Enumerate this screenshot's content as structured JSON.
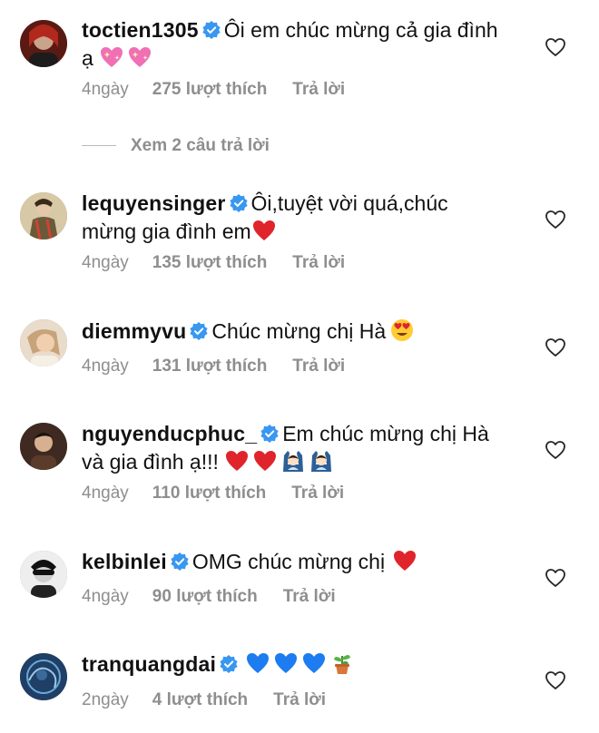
{
  "comments": [
    {
      "username": "toctien1305",
      "text": "Ôi em chúc mừng cả gia đình ạ",
      "emojis": [
        "sparkling-heart",
        "sparkling-heart"
      ],
      "time": "4ngày",
      "likes": "275 lượt thích",
      "reply": "Trả lời"
    },
    {
      "username": "lequyensinger",
      "text": "Ôi,tuyệt vời quá,chúc mừng gia đình em",
      "emojis": [
        "red-heart"
      ],
      "time": "4ngày",
      "likes": "135 lượt thích",
      "reply": "Trả lời"
    },
    {
      "username": "diemmyvu",
      "text": "Chúc mừng chị Hà",
      "emojis": [
        "heart-eyes"
      ],
      "time": "4ngày",
      "likes": "131 lượt thích",
      "reply": "Trả lời"
    },
    {
      "username": "nguyenducphuc_",
      "text": "Em chúc mừng chị Hà và gia đình ạ!!!",
      "emojis": [
        "red-heart",
        "red-heart",
        "raising-hands-person",
        "raising-hands-person"
      ],
      "time": "4ngày",
      "likes": "110 lượt thích",
      "reply": "Trả lời"
    },
    {
      "username": "kelbinlei",
      "text": "OMG chúc mừng chị",
      "emojis": [
        "red-heart"
      ],
      "time": "4ngày",
      "likes": "90 lượt thích",
      "reply": "Trả lời"
    },
    {
      "username": "tranquangdai",
      "text": "",
      "emojis": [
        "blue-heart",
        "blue-heart",
        "blue-heart",
        "potted-plant"
      ],
      "time": "2ngày",
      "likes": "4 lượt thích",
      "reply": "Trả lời"
    }
  ],
  "view_replies": "Xem 2 câu trả lời",
  "colors": {
    "verified": "#3897f0",
    "meta": "#8e8e8e",
    "text": "#111111"
  },
  "icons": {
    "verified": "verified-badge-icon",
    "like": "heart-outline-icon"
  }
}
